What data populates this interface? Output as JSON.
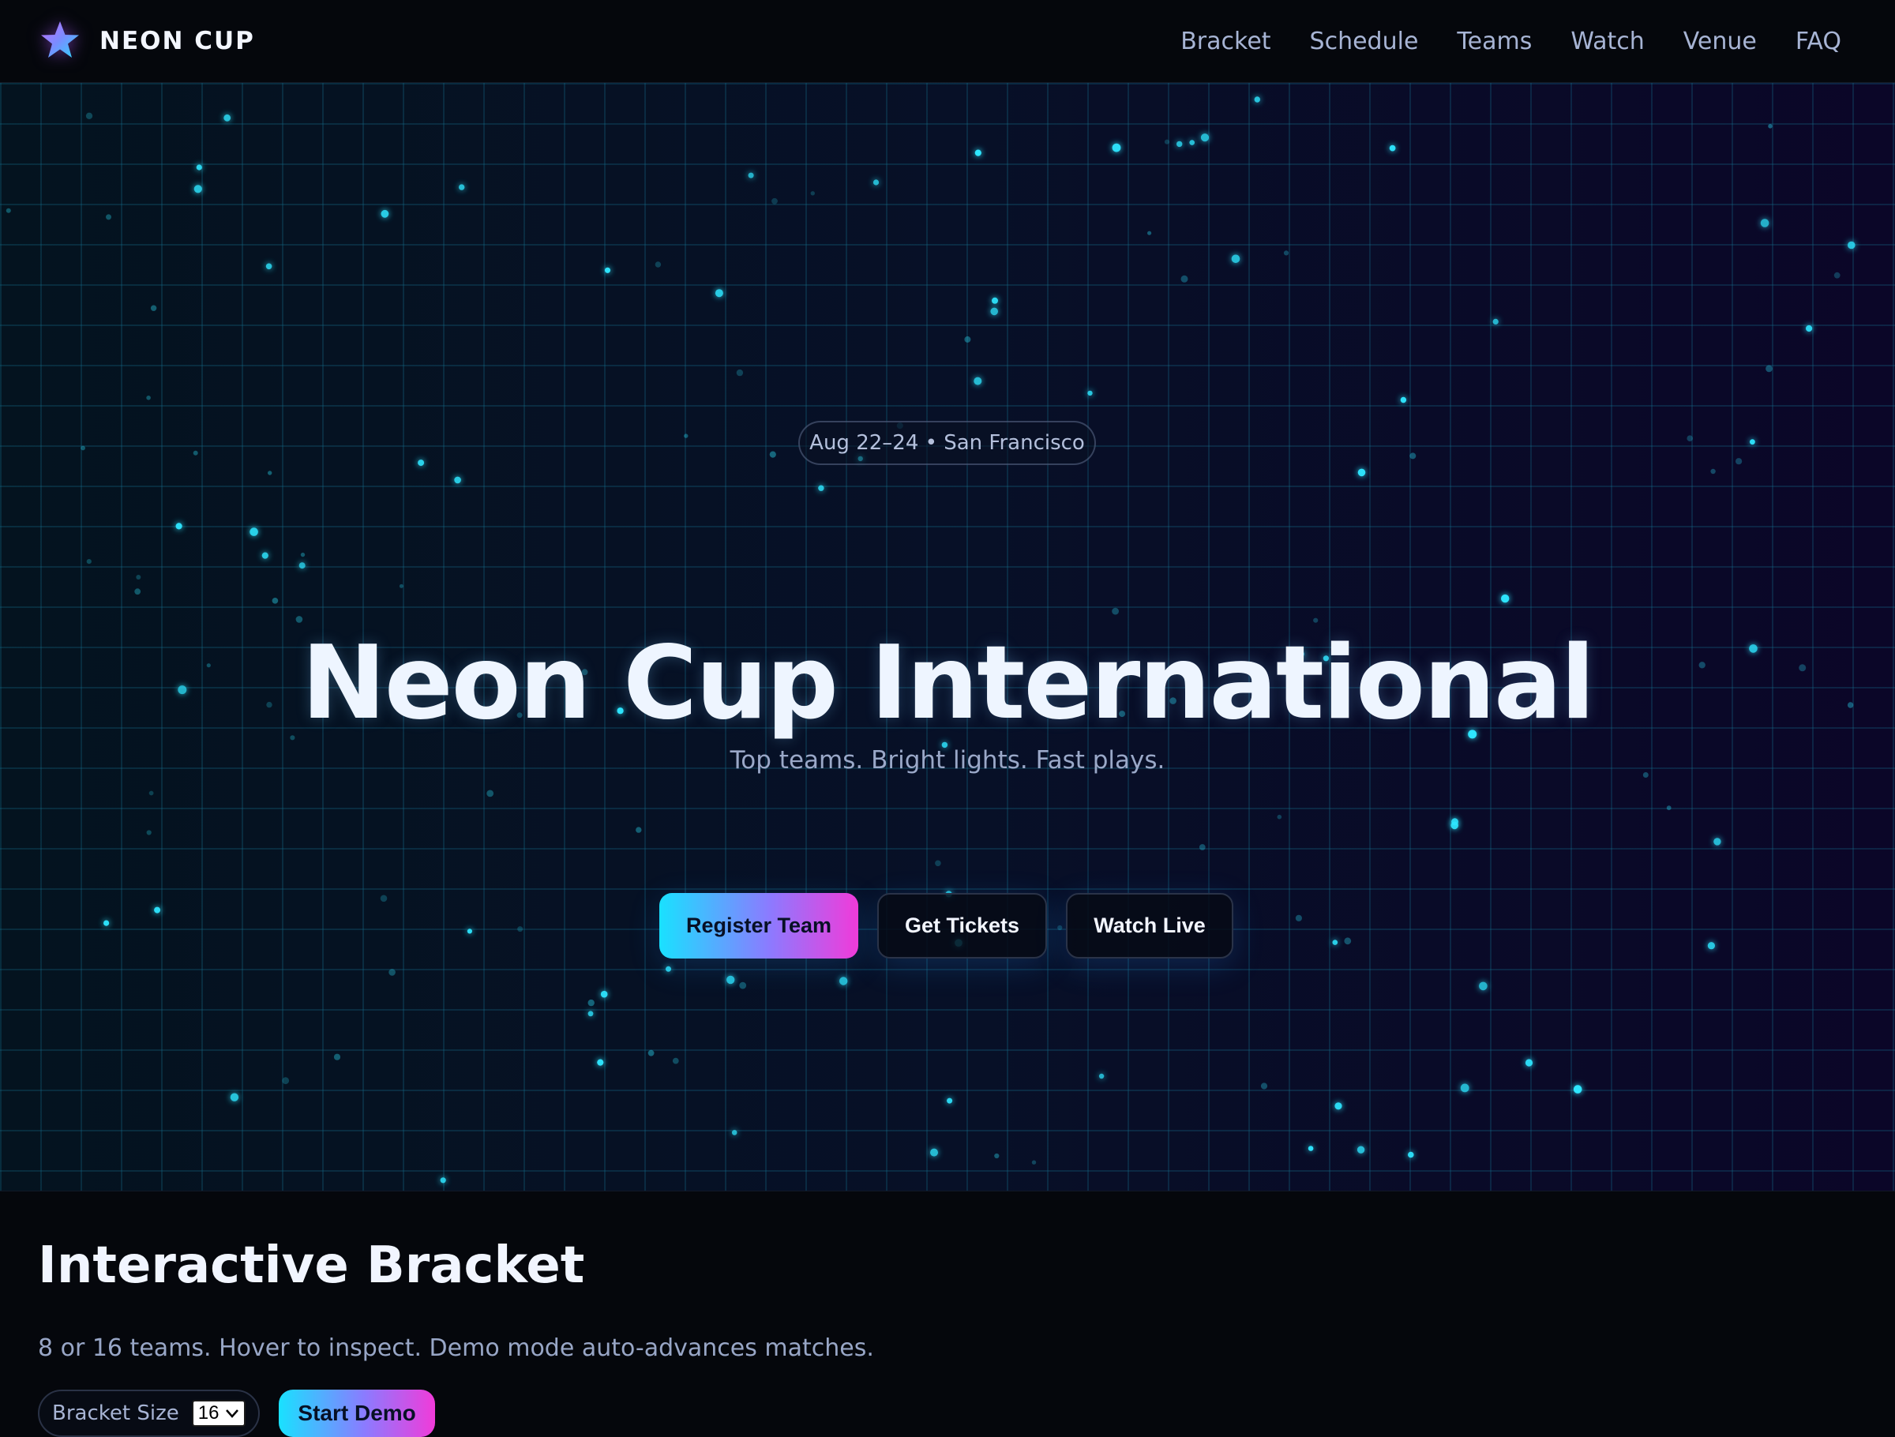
{
  "navbar": {
    "brand_name": "NEON CUP",
    "links": [
      "Bracket",
      "Schedule",
      "Teams",
      "Watch",
      "Venue",
      "FAQ"
    ]
  },
  "hero": {
    "pill": "Aug 22–24 • San Francisco",
    "title": "Neon Cup International",
    "subtitle": "Top teams. Bright lights. Fast plays.",
    "buttons": {
      "register": "Register Team",
      "tickets": "Get Tickets",
      "watch": "Watch Live"
    }
  },
  "bracket": {
    "title": "Interactive Bracket",
    "description": "8 or 16 teams. Hover to inspect. Demo mode auto-advances matches.",
    "size_label": "Bracket Size",
    "size_value": "16",
    "demo_button": "Start Demo"
  },
  "colors": {
    "accent_cyan": "#19e1ff",
    "accent_purple": "#8b7bff",
    "accent_magenta": "#f13bd9",
    "particle": "#2fe6ff"
  }
}
